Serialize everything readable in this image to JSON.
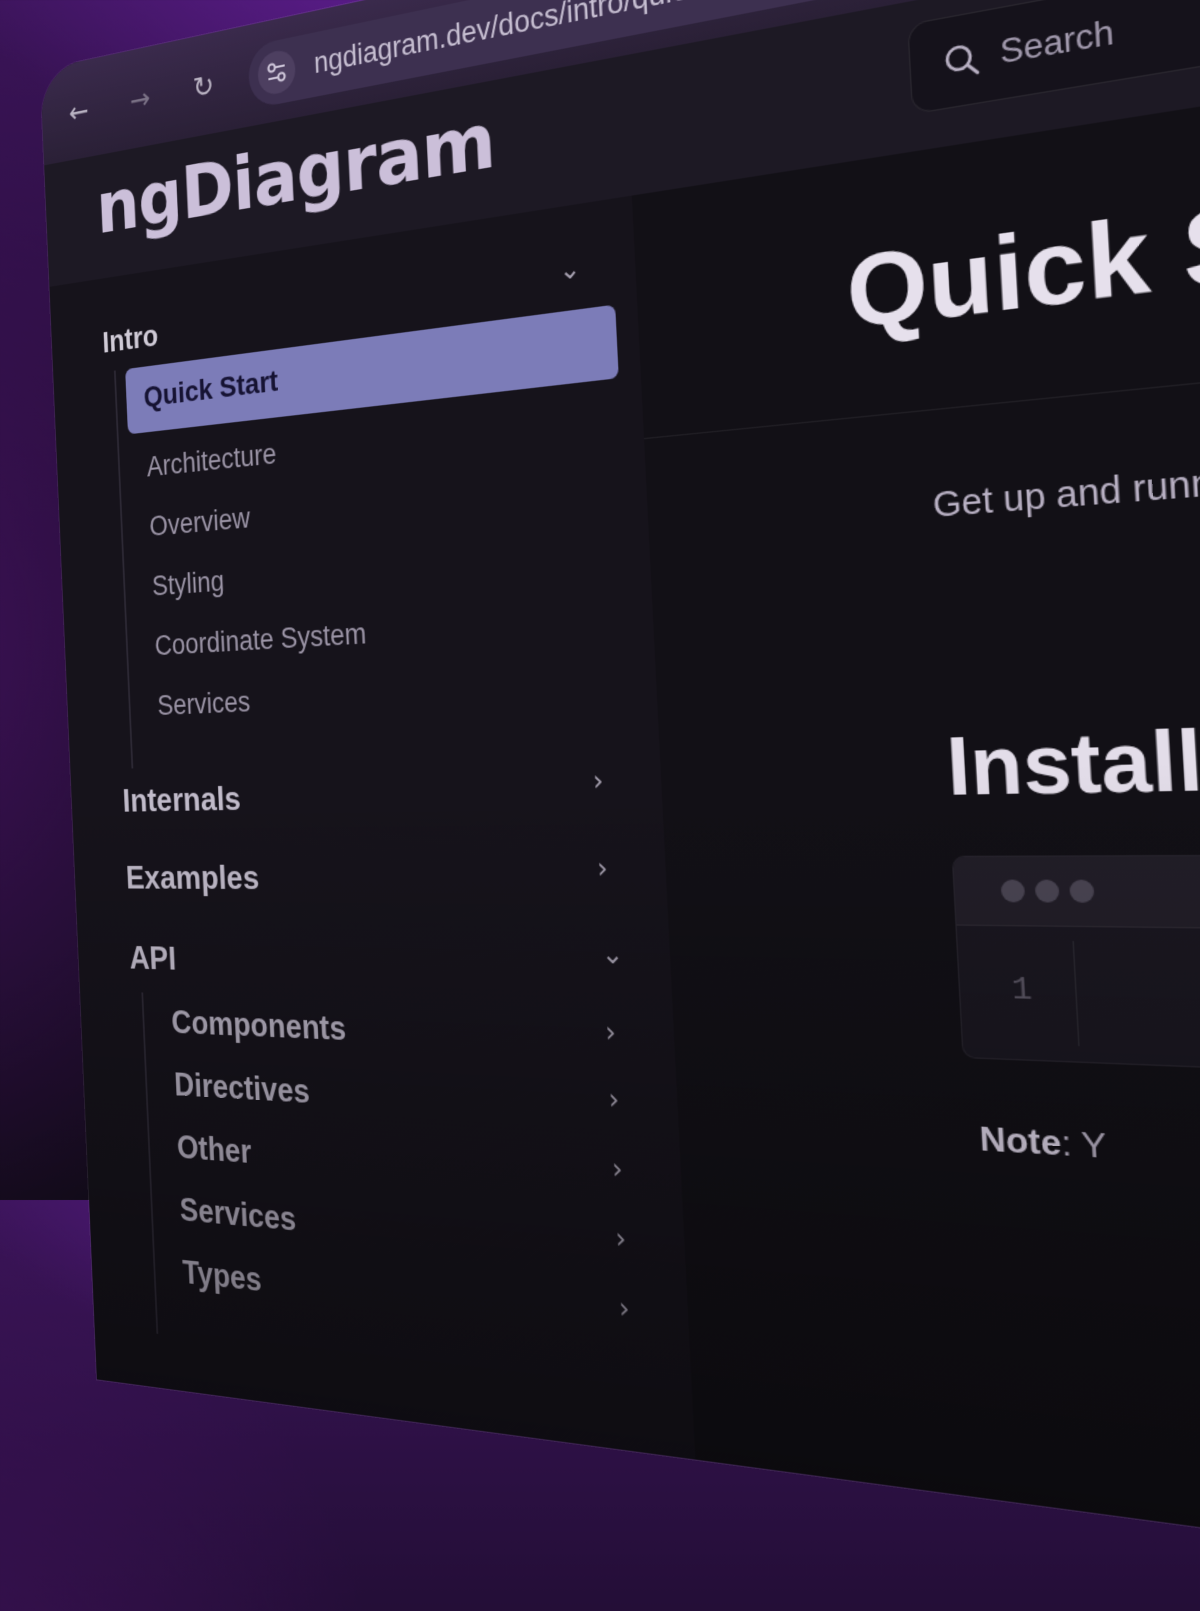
{
  "browser": {
    "url": "ngdiagram.dev/docs/intro/quick-start/",
    "back_icon": "←",
    "forward_icon": "→",
    "reload_icon": "↻"
  },
  "header": {
    "logo": "ngDiagram",
    "search_placeholder": "Search"
  },
  "sidebar": {
    "intro_label": "Intro",
    "intro_items": [
      "Quick Start",
      "Architecture",
      "Overview",
      "Styling",
      "Coordinate System",
      "Services"
    ],
    "internals_label": "Internals",
    "examples_label": "Examples",
    "api_label": "API",
    "api_items": [
      "Components",
      "Directives",
      "Other",
      "Services",
      "Types"
    ]
  },
  "main": {
    "title": "Quick S",
    "lead": "Get up and runn diagram.",
    "install_heading": "Install",
    "code_line_number": "1",
    "note_label": "Note",
    "note_rest": ": Y"
  },
  "colors": {
    "accent": "#7c7cb8",
    "background": "#17141d",
    "gradient_purple": "#6c21a6"
  }
}
